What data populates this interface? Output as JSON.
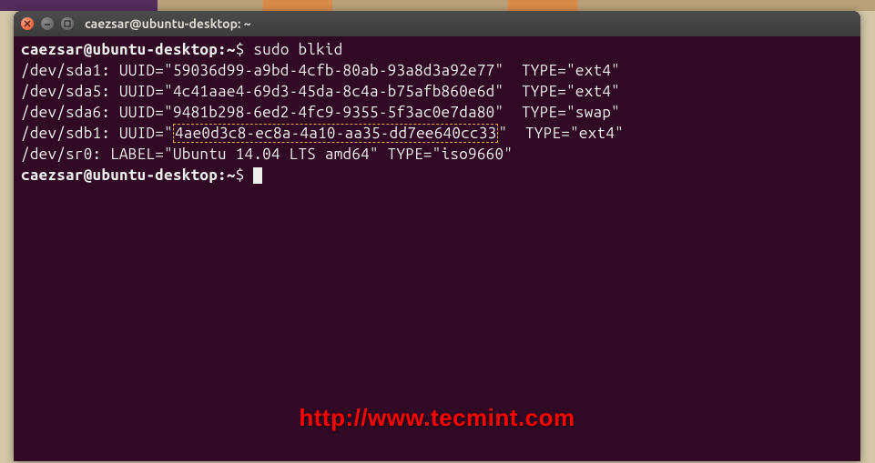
{
  "window": {
    "title": "caezsar@ubuntu-desktop: ~"
  },
  "prompt": {
    "user_host": "caezsar@ubuntu-desktop",
    "path": "~",
    "symbol": "$"
  },
  "command": "sudo blkid",
  "output": {
    "lines": [
      {
        "device": "/dev/sda1:",
        "uuid_label": "UUID=",
        "uuid": "\"59036d99-a9bd-4cfb-80ab-93a8d3a92e77\"",
        "type_label": "TYPE=",
        "type": "\"ext4\""
      },
      {
        "device": "/dev/sda5:",
        "uuid_label": "UUID=",
        "uuid": "\"4c41aae4-69d3-45da-8c4a-b75afb860e6d\"",
        "type_label": "TYPE=",
        "type": "\"ext4\""
      },
      {
        "device": "/dev/sda6:",
        "uuid_label": "UUID=",
        "uuid": "\"9481b298-6ed2-4fc9-9355-5f3ac0e7da80\"",
        "type_label": "TYPE=",
        "type": "\"swap\""
      },
      {
        "device": "/dev/sdb1:",
        "uuid_label": "UUID=\"",
        "uuid_highlighted": "4ae0d3c8-ec8a-4a10-aa35-dd7ee640cc33",
        "uuid_close": "\"",
        "type_label": "TYPE=",
        "type": "\"ext4\""
      }
    ],
    "sr0": {
      "device": "/dev/sr0:",
      "label_key": "LABEL=",
      "label_val": "\"Ubuntu 14.04 LTS amd64\"",
      "type_label": "TYPE=",
      "type": "\"iso9660\""
    }
  },
  "watermark": "http://www.tecmint.com"
}
